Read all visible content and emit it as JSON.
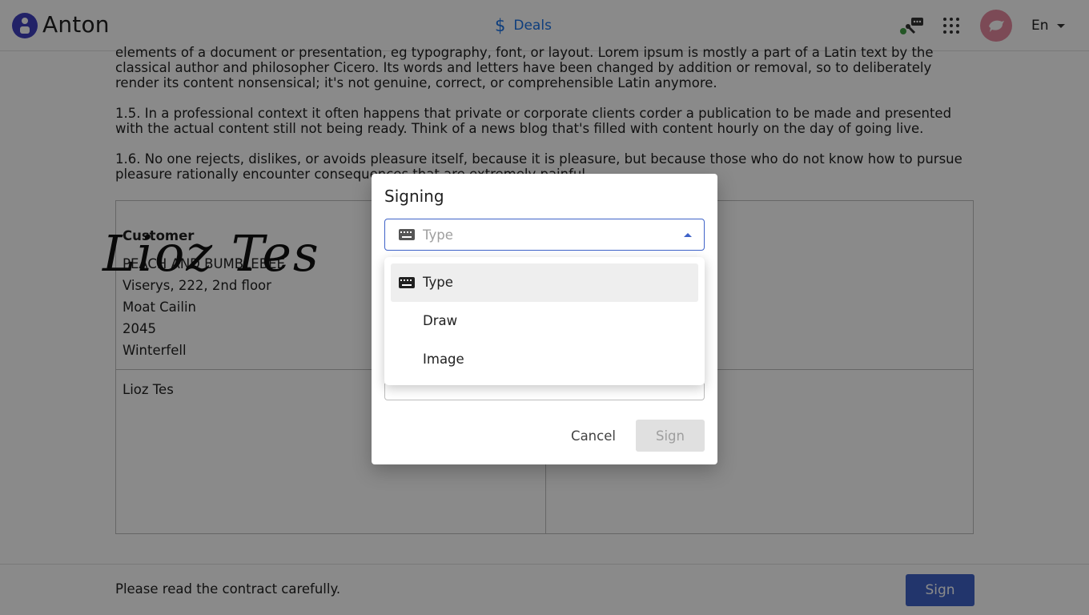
{
  "header": {
    "brand": "Anton",
    "nav_deals": "Deals",
    "language": "En"
  },
  "document": {
    "paragraphs": [
      "elements of a document or presentation, eg typography, font, or layout. Lorem ipsum is mostly a part of a Latin text by the classical author and philosopher Cicero. Its words and letters have been changed by addition or removal, so to deliberately render its content nonsensical; it's not genuine, correct, or comprehensible Latin anymore.",
      "1.5. In a professional context it often happens that private or corporate clients corder a publication to be made and presented with the actual content still not being ready. Think of a news blog that's filled with content hourly on the day of going live.",
      "1.6. No one rejects, dislikes, or avoids pleasure itself, because it is pleasure, but because those who do not know how to pursue pleasure rationally encounter consequences that are extremely painful."
    ],
    "customer_label": "Customer",
    "customer_lines": [
      "PEACH AND BUMBLEBEE",
      "Viserys, 222, 2nd floor",
      "Moat Cailin",
      "2045",
      "Winterfell"
    ],
    "signer_name": "Lioz Tes",
    "signature_text": "Lioz Tes"
  },
  "footer": {
    "message": "Please read the contract carefully.",
    "sign_label": "Sign"
  },
  "dialog": {
    "title": "Signing",
    "select_value": "Type",
    "options": [
      "Type",
      "Draw",
      "Image"
    ],
    "cancel_label": "Cancel",
    "sign_label": "Sign"
  },
  "colors": {
    "accent": "#3f63c8",
    "link": "#1a73e8",
    "logo": "#3f3fbf",
    "avatar": "#e58aa0",
    "status_online": "#43a047"
  }
}
